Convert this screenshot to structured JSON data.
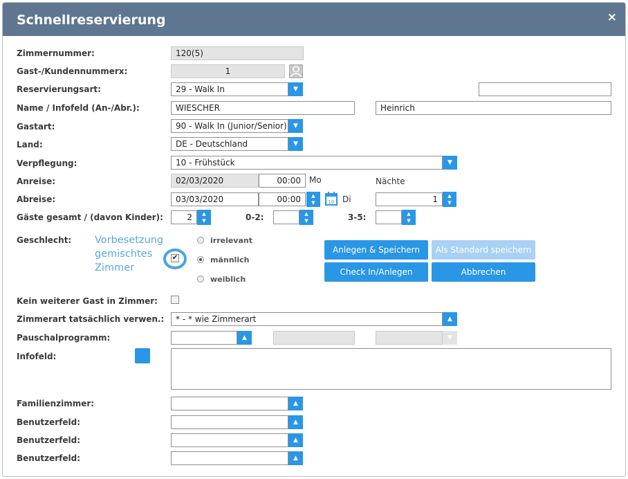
{
  "dialog": {
    "title": "Schnellreservierung",
    "close_icon": "×"
  },
  "labels": {
    "zimmernummer": "Zimmernummer:",
    "gast": "Gast-/Kundennummerx:",
    "reservierungsart": "Reservierungsart:",
    "name": "Name / Infofeld (An-/Abr.):",
    "gastart": "Gastart:",
    "land": "Land:",
    "verpflegung": "Verpflegung:",
    "anreise": "Anreise:",
    "abreise": "Abreise:",
    "gaeste": "Gäste gesamt / (davon Kinder):",
    "kinder_02": "0-2:",
    "kinder_35": "3-5:",
    "geschlecht": "Geschlecht:",
    "kein_gast": "Kein weiterer Gast in Zimmer:",
    "zimmerart": "Zimmerart tatsächlich verwen.:",
    "pauschal": "Pauschalprogramm:",
    "infofeld": "Infofeld:",
    "familienzimmer": "Familienzimmer:",
    "benutzer1": "Benutzerfeld:",
    "benutzer2": "Benutzerfeld:",
    "benutzer3": "Benutzerfeld:",
    "naechte": "Nächte"
  },
  "fields": {
    "zimmernummer": "120(5)",
    "gast_nr": "1",
    "reservierungsart": "29 - Walk In",
    "reservierungsart_extra": "",
    "nachname": "WIESCHER",
    "vorname": "Heinrich",
    "gastart": "90 - Walk In (Junior/Senior)",
    "land": "DE - Deutschland",
    "verpflegung": "10 - Frühstück",
    "anreise_datum": "02/03/2020",
    "anreise_zeit": "00:00",
    "anreise_tag": "Mo",
    "abreise_datum": "03/03/2020",
    "abreise_zeit": "00:00",
    "abreise_tag": "Di",
    "naechte": "1",
    "gaeste": "2",
    "kinder_02": "",
    "kinder_35": "",
    "zimmerart": "* - * wie Zimmerart",
    "pauschal": "",
    "pauschal2": "",
    "pauschal3": "",
    "familienzimmer": "",
    "benutzer1": "",
    "benutzer2": "",
    "benutzer3": ""
  },
  "geschlecht": {
    "hint": "Vorbesetzung gemischtes Zimmer",
    "hint_lines": [
      "Vorbesetzung",
      "gemischtes",
      "Zimmer"
    ],
    "checkbox_checked": true,
    "options": [
      "irrelevant",
      "männlich",
      "weiblich"
    ],
    "selected": "männlich"
  },
  "kein_gast_checked": false,
  "buttons": {
    "anlegen_speichern": "Anlegen & Speichern",
    "als_standard": "Als Standard speichern",
    "check_in": "Check In/Anlegen",
    "abbrechen": "Abbrechen"
  },
  "colors": {
    "titlebar": "#5f7690",
    "accent": "#2a96e6",
    "accent_disabled": "#a8d1f4",
    "hint": "#59a7e0"
  }
}
